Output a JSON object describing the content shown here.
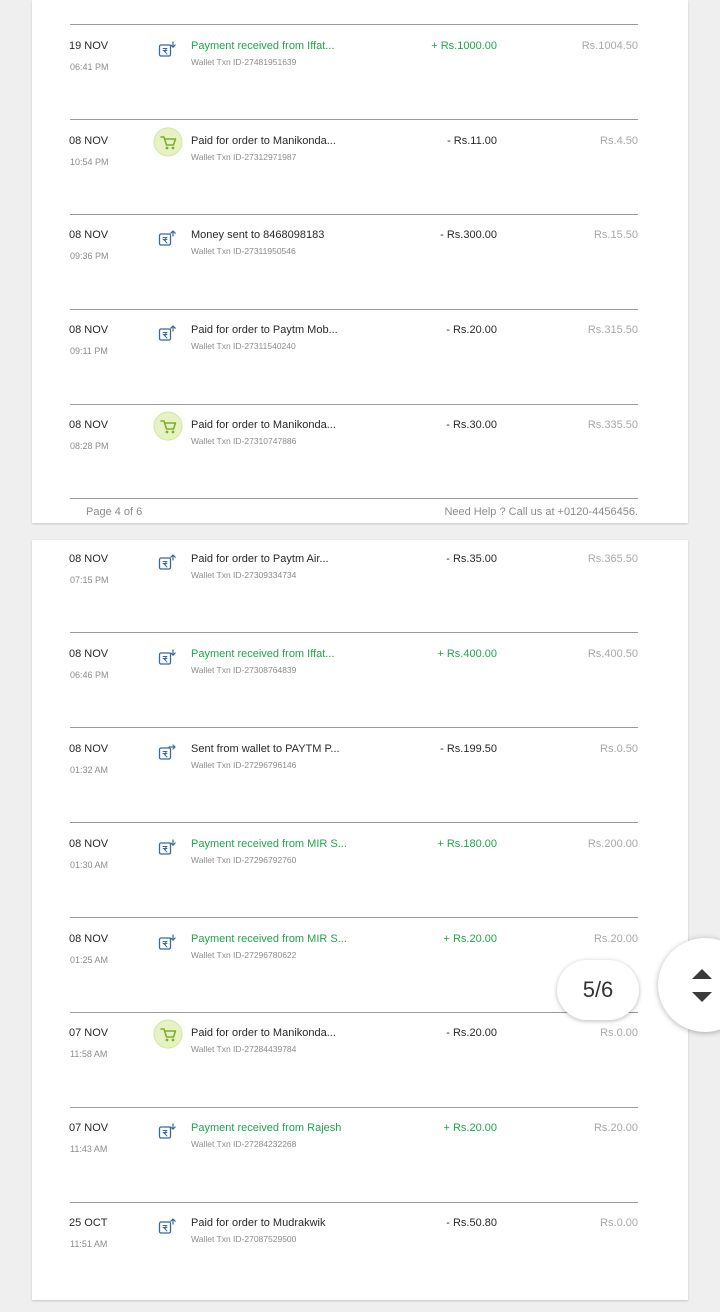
{
  "colors": {
    "credit": "#1fa54a",
    "debit": "#2a2a2a",
    "muted": "#8c8c8c",
    "balance": "#a8a8a8",
    "icon_blue": "#3a6a9a",
    "cart_bg": "#e6f2c4",
    "cart_green": "#7fae2c"
  },
  "pages": [
    {
      "rows": [
        {
          "date": "19 NOV",
          "time": "06:41 PM",
          "icon": "wallet-receive-icon",
          "type": "credit",
          "desc": "Payment received from Iffat...",
          "txn": "Wallet Txn ID-27481951639",
          "amount": "+ Rs.1000.00",
          "balance": "Rs.1004.50"
        },
        {
          "date": "08 NOV",
          "time": "10:54 PM",
          "icon": "shopping-cart-icon",
          "type": "debit",
          "desc": "Paid for order to Manikonda...",
          "txn": "Wallet Txn ID-27312971987",
          "amount": "- Rs.11.00",
          "balance": "Rs.4.50"
        },
        {
          "date": "08 NOV",
          "time": "09:36 PM",
          "icon": "wallet-send-icon",
          "type": "debit",
          "desc": "Money sent to 8468098183",
          "txn": "Wallet Txn ID-27311950546",
          "amount": "- Rs.300.00",
          "balance": "Rs.15.50"
        },
        {
          "date": "08 NOV",
          "time": "09:11 PM",
          "icon": "wallet-send-icon",
          "type": "debit",
          "desc": "Paid for order to Paytm Mob...",
          "txn": "Wallet Txn ID-27311540240",
          "amount": "- Rs.20.00",
          "balance": "Rs.315.50"
        },
        {
          "date": "08 NOV",
          "time": "08:28 PM",
          "icon": "shopping-cart-icon",
          "type": "debit",
          "desc": "Paid for order to Manikonda...",
          "txn": "Wallet Txn ID-27310747886",
          "amount": "- Rs.30.00",
          "balance": "Rs.335.50"
        }
      ],
      "footer": {
        "page_label": "Page 4 of 6",
        "help": "Need Help ? Call us at +0120-4456456."
      }
    },
    {
      "rows": [
        {
          "date": "08 NOV",
          "time": "07:15 PM",
          "icon": "wallet-send-icon",
          "type": "debit",
          "desc": "Paid for order to Paytm Air...",
          "txn": "Wallet Txn ID-27309334734",
          "amount": "- Rs.35.00",
          "balance": "Rs.365.50"
        },
        {
          "date": "08 NOV",
          "time": "06:46 PM",
          "icon": "wallet-receive-icon",
          "type": "credit",
          "desc": "Payment received from Iffat...",
          "txn": "Wallet Txn ID-27308764839",
          "amount": "+ Rs.400.00",
          "balance": "Rs.400.50"
        },
        {
          "date": "08 NOV",
          "time": "01:32 AM",
          "icon": "bank-transfer-icon",
          "type": "debit",
          "desc": "Sent from wallet to PAYTM P...",
          "txn": "Wallet Txn ID-27296796146",
          "amount": "- Rs.199.50",
          "balance": "Rs.0.50"
        },
        {
          "date": "08 NOV",
          "time": "01:30 AM",
          "icon": "wallet-receive-icon",
          "type": "credit",
          "desc": "Payment received from MIR S...",
          "txn": "Wallet Txn ID-27296792760",
          "amount": "+ Rs.180.00",
          "balance": "Rs.200.00"
        },
        {
          "date": "08 NOV",
          "time": "01:25 AM",
          "icon": "wallet-receive-icon",
          "type": "credit",
          "desc": "Payment received from MIR S...",
          "txn": "Wallet Txn ID-27296780622",
          "amount": "+ Rs.20.00",
          "balance": "Rs.20.00"
        },
        {
          "date": "07 NOV",
          "time": "11:58 AM",
          "icon": "shopping-cart-icon",
          "type": "debit",
          "desc": "Paid for order to Manikonda...",
          "txn": "Wallet Txn ID-27284439784",
          "amount": "- Rs.20.00",
          "balance": "Rs.0.00"
        },
        {
          "date": "07 NOV",
          "time": "11:43 AM",
          "icon": "wallet-receive-icon",
          "type": "credit",
          "desc": "Payment received from Rajesh",
          "txn": "Wallet Txn ID-27284232268",
          "amount": "+ Rs.20.00",
          "balance": "Rs.20.00"
        },
        {
          "date": "25 OCT",
          "time": "11:51 AM",
          "icon": "wallet-send-icon",
          "type": "debit",
          "desc": "Paid for order to Mudrakwik",
          "txn": "Wallet Txn ID-27087529500",
          "amount": "- Rs.50.80",
          "balance": "Rs.0.00"
        }
      ]
    }
  ],
  "viewer": {
    "page_indicator": "5/6",
    "scroll_icon": "page-scroll-arrows-icon"
  }
}
